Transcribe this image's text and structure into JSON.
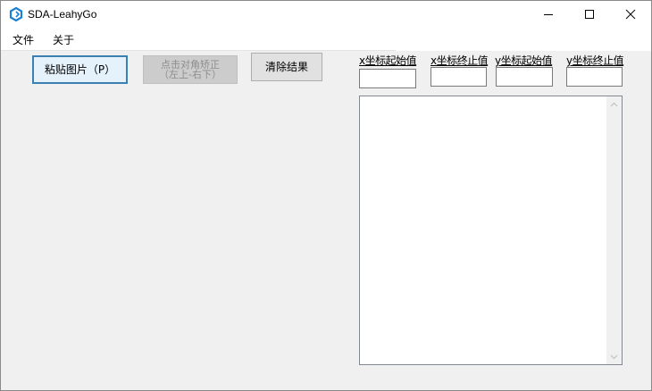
{
  "window": {
    "title": "SDA-LeahyGo",
    "icon": "app-logo-icon",
    "controls": [
      "minimize-icon",
      "maximize-icon",
      "close-icon"
    ]
  },
  "menu": {
    "file": "文件",
    "about": "关于"
  },
  "toolbar": {
    "paste_label": "粘贴图片（P）",
    "calibrate_line1": "点击对角矫正",
    "calibrate_line2": "（左上-右下）",
    "clear_label": "清除结果"
  },
  "coords": {
    "x_start_label": "x坐标起始值",
    "x_end_label": "x坐标终止值",
    "y_start_label": "y坐标起始值",
    "y_end_label": "y坐标终止值",
    "x_start_value": "",
    "x_end_value": "",
    "y_start_value": "",
    "y_end_value": ""
  },
  "result": {
    "text": ""
  },
  "colors": {
    "accent": "#3c7fb1",
    "titlebar": "#ffffff",
    "background": "#f0f0f0"
  }
}
